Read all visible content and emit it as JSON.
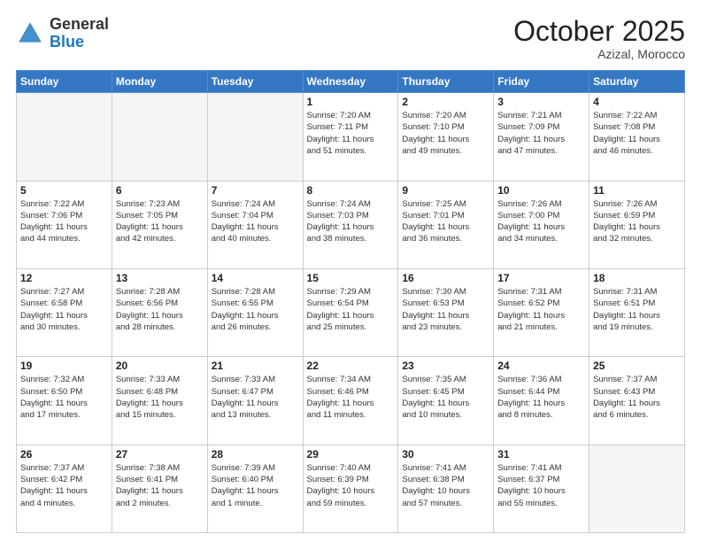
{
  "header": {
    "logo_general": "General",
    "logo_blue": "Blue",
    "month_title": "October 2025",
    "location": "Azizal, Morocco"
  },
  "weekdays": [
    "Sunday",
    "Monday",
    "Tuesday",
    "Wednesday",
    "Thursday",
    "Friday",
    "Saturday"
  ],
  "weeks": [
    [
      {
        "day": "",
        "info": ""
      },
      {
        "day": "",
        "info": ""
      },
      {
        "day": "",
        "info": ""
      },
      {
        "day": "1",
        "info": "Sunrise: 7:20 AM\nSunset: 7:11 PM\nDaylight: 11 hours\nand 51 minutes."
      },
      {
        "day": "2",
        "info": "Sunrise: 7:20 AM\nSunset: 7:10 PM\nDaylight: 11 hours\nand 49 minutes."
      },
      {
        "day": "3",
        "info": "Sunrise: 7:21 AM\nSunset: 7:09 PM\nDaylight: 11 hours\nand 47 minutes."
      },
      {
        "day": "4",
        "info": "Sunrise: 7:22 AM\nSunset: 7:08 PM\nDaylight: 11 hours\nand 46 minutes."
      }
    ],
    [
      {
        "day": "5",
        "info": "Sunrise: 7:22 AM\nSunset: 7:06 PM\nDaylight: 11 hours\nand 44 minutes."
      },
      {
        "day": "6",
        "info": "Sunrise: 7:23 AM\nSunset: 7:05 PM\nDaylight: 11 hours\nand 42 minutes."
      },
      {
        "day": "7",
        "info": "Sunrise: 7:24 AM\nSunset: 7:04 PM\nDaylight: 11 hours\nand 40 minutes."
      },
      {
        "day": "8",
        "info": "Sunrise: 7:24 AM\nSunset: 7:03 PM\nDaylight: 11 hours\nand 38 minutes."
      },
      {
        "day": "9",
        "info": "Sunrise: 7:25 AM\nSunset: 7:01 PM\nDaylight: 11 hours\nand 36 minutes."
      },
      {
        "day": "10",
        "info": "Sunrise: 7:26 AM\nSunset: 7:00 PM\nDaylight: 11 hours\nand 34 minutes."
      },
      {
        "day": "11",
        "info": "Sunrise: 7:26 AM\nSunset: 6:59 PM\nDaylight: 11 hours\nand 32 minutes."
      }
    ],
    [
      {
        "day": "12",
        "info": "Sunrise: 7:27 AM\nSunset: 6:58 PM\nDaylight: 11 hours\nand 30 minutes."
      },
      {
        "day": "13",
        "info": "Sunrise: 7:28 AM\nSunset: 6:56 PM\nDaylight: 11 hours\nand 28 minutes."
      },
      {
        "day": "14",
        "info": "Sunrise: 7:28 AM\nSunset: 6:55 PM\nDaylight: 11 hours\nand 26 minutes."
      },
      {
        "day": "15",
        "info": "Sunrise: 7:29 AM\nSunset: 6:54 PM\nDaylight: 11 hours\nand 25 minutes."
      },
      {
        "day": "16",
        "info": "Sunrise: 7:30 AM\nSunset: 6:53 PM\nDaylight: 11 hours\nand 23 minutes."
      },
      {
        "day": "17",
        "info": "Sunrise: 7:31 AM\nSunset: 6:52 PM\nDaylight: 11 hours\nand 21 minutes."
      },
      {
        "day": "18",
        "info": "Sunrise: 7:31 AM\nSunset: 6:51 PM\nDaylight: 11 hours\nand 19 minutes."
      }
    ],
    [
      {
        "day": "19",
        "info": "Sunrise: 7:32 AM\nSunset: 6:50 PM\nDaylight: 11 hours\nand 17 minutes."
      },
      {
        "day": "20",
        "info": "Sunrise: 7:33 AM\nSunset: 6:48 PM\nDaylight: 11 hours\nand 15 minutes."
      },
      {
        "day": "21",
        "info": "Sunrise: 7:33 AM\nSunset: 6:47 PM\nDaylight: 11 hours\nand 13 minutes."
      },
      {
        "day": "22",
        "info": "Sunrise: 7:34 AM\nSunset: 6:46 PM\nDaylight: 11 hours\nand 11 minutes."
      },
      {
        "day": "23",
        "info": "Sunrise: 7:35 AM\nSunset: 6:45 PM\nDaylight: 11 hours\nand 10 minutes."
      },
      {
        "day": "24",
        "info": "Sunrise: 7:36 AM\nSunset: 6:44 PM\nDaylight: 11 hours\nand 8 minutes."
      },
      {
        "day": "25",
        "info": "Sunrise: 7:37 AM\nSunset: 6:43 PM\nDaylight: 11 hours\nand 6 minutes."
      }
    ],
    [
      {
        "day": "26",
        "info": "Sunrise: 7:37 AM\nSunset: 6:42 PM\nDaylight: 11 hours\nand 4 minutes."
      },
      {
        "day": "27",
        "info": "Sunrise: 7:38 AM\nSunset: 6:41 PM\nDaylight: 11 hours\nand 2 minutes."
      },
      {
        "day": "28",
        "info": "Sunrise: 7:39 AM\nSunset: 6:40 PM\nDaylight: 11 hours\nand 1 minute."
      },
      {
        "day": "29",
        "info": "Sunrise: 7:40 AM\nSunset: 6:39 PM\nDaylight: 10 hours\nand 59 minutes."
      },
      {
        "day": "30",
        "info": "Sunrise: 7:41 AM\nSunset: 6:38 PM\nDaylight: 10 hours\nand 57 minutes."
      },
      {
        "day": "31",
        "info": "Sunrise: 7:41 AM\nSunset: 6:37 PM\nDaylight: 10 hours\nand 55 minutes."
      },
      {
        "day": "",
        "info": ""
      }
    ]
  ]
}
